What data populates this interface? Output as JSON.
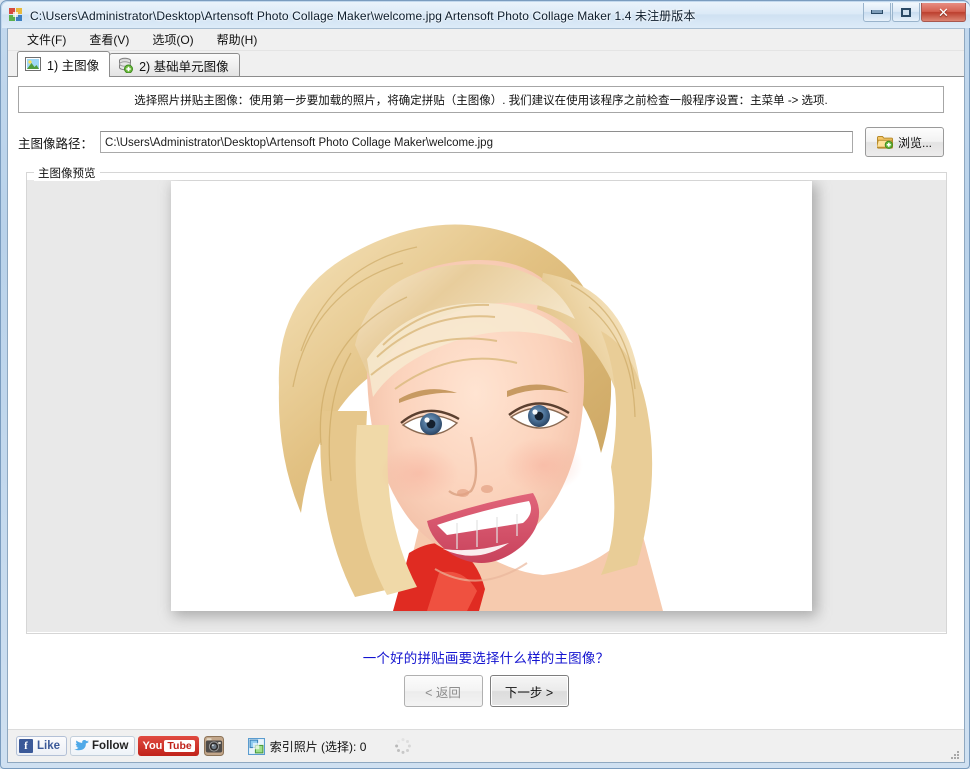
{
  "window": {
    "title": "C:\\Users\\Administrator\\Desktop\\Artensoft Photo Collage Maker\\welcome.jpg Artensoft Photo Collage Maker 1.4  未注册版本",
    "app_icon": "app-logo-icon",
    "controls": {
      "minimize": "minimize-icon",
      "maximize": "maximize-icon",
      "close": "✕"
    }
  },
  "menu": {
    "items": [
      {
        "label": "文件(F)"
      },
      {
        "label": "查看(V)"
      },
      {
        "label": "选项(O)"
      },
      {
        "label": "帮助(H)"
      }
    ]
  },
  "tabs": [
    {
      "label": "1) 主图像",
      "icon": "picture-icon",
      "active": true
    },
    {
      "label": "2) 基础单元图像",
      "icon": "database-add-icon",
      "active": false
    }
  ],
  "banner": {
    "text": "选择照片拼贴主图像：使用第一步要加载的照片，将确定拼贴（主图像）. 我们建议在使用该程序之前检查一般程序设置：主菜单 -> 选项."
  },
  "path_row": {
    "label": "主图像路径：",
    "value": "C:\\Users\\Administrator\\Desktop\\Artensoft Photo Collage Maker\\welcome.jpg",
    "placeholder": "",
    "browse_label": "浏览...",
    "browse_icon": "folder-add-icon"
  },
  "preview": {
    "group_label": "主图像预览",
    "image_alt": "welcome.jpg"
  },
  "link": {
    "text": "一个好的拼贴画要选择什么样的主图像？",
    "color": "#1414d0"
  },
  "nav": {
    "back_label": "< 返回",
    "next_label": "下一步 >"
  },
  "status": {
    "facebook_label": "Like",
    "facebook_mark": "f",
    "twitter_label": "Follow",
    "youtube_label": "You",
    "youtube_label2": "Tube",
    "instagram_icon": "instagram-icon",
    "index_icon": "index-photos-icon",
    "index_text": "索引照片 (选择): 0",
    "spinner_icon": "loading-spinner-icon"
  }
}
